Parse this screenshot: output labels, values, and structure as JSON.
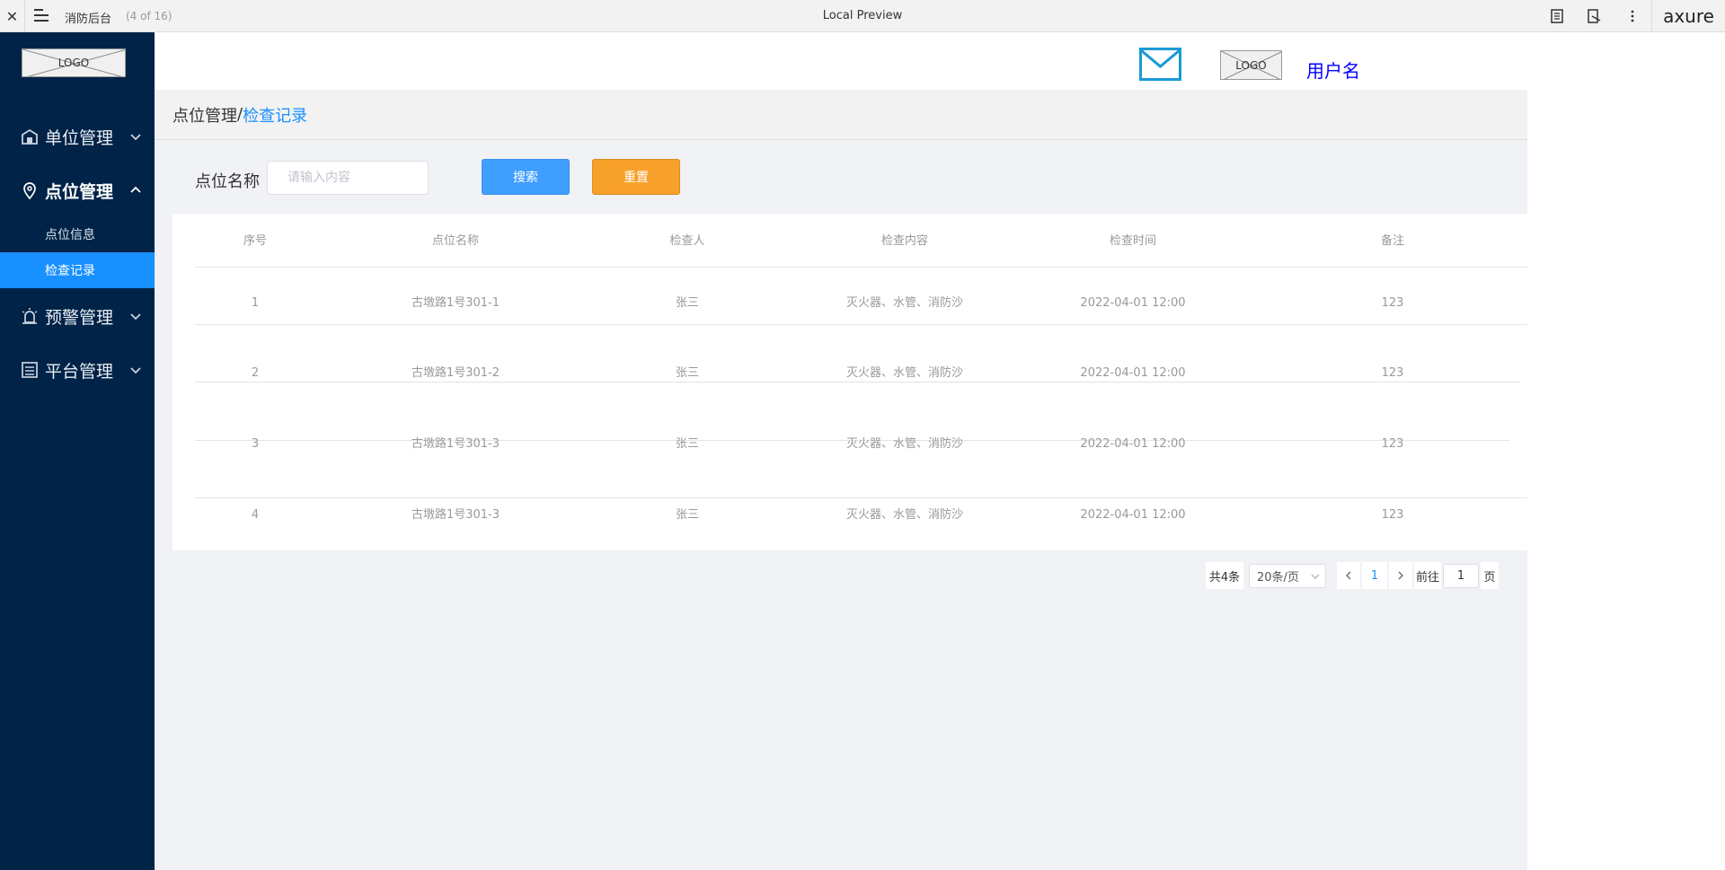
{
  "topbar": {
    "close_icon": "close-icon",
    "menu_icon": "menu-icon",
    "project": "消防后台",
    "page_count": "(4 of 16)",
    "title": "Local Preview",
    "tools": [
      "notes-icon",
      "inspect-icon",
      "more-vertical-icon"
    ],
    "brand": "axure"
  },
  "sidebar": {
    "logo": "LOGO",
    "items": [
      {
        "label": "单位管理",
        "icon": "building-icon",
        "open": false
      },
      {
        "label": "点位管理",
        "icon": "location-pin-icon",
        "open": true,
        "children": [
          {
            "label": "点位信息",
            "active": false
          },
          {
            "label": "检查记录",
            "active": true
          }
        ]
      },
      {
        "label": "预警管理",
        "icon": "alarm-icon",
        "open": false
      },
      {
        "label": "平台管理",
        "icon": "document-list-icon",
        "open": false
      }
    ]
  },
  "header": {
    "mail_icon": "mail-icon",
    "avatar_logo": "LOGO",
    "username": "用户名"
  },
  "breadcrumb": {
    "parent": "点位管理",
    "separator": "/",
    "current": "检查记录"
  },
  "filter": {
    "label": "点位名称",
    "placeholder": "请输入内容",
    "search_label": "搜索",
    "reset_label": "重置"
  },
  "table": {
    "columns": [
      "序号",
      "点位名称",
      "检查人",
      "检查内容",
      "检查时间",
      "备注"
    ],
    "rows": [
      [
        "1",
        "古墩路1号301-1",
        "张三",
        "灭火器、水管、消防沙",
        "2022-04-01 12:00",
        "123"
      ],
      [
        "2",
        "古墩路1号301-2",
        "张三",
        "灭火器、水管、消防沙",
        "2022-04-01 12:00",
        "123"
      ],
      [
        "3",
        "古墩路1号301-3",
        "张三",
        "灭火器、水管、消防沙",
        "2022-04-01 12:00",
        "123"
      ],
      [
        "4",
        "古墩路1号301-3",
        "张三",
        "灭火器、水管、消防沙",
        "2022-04-01 12:00",
        "123"
      ]
    ]
  },
  "pagination": {
    "total": "共4条",
    "page_size": "20条/页",
    "current_page": "1",
    "goto_label": "前往",
    "goto_value": "1",
    "page_word": "页"
  },
  "colors": {
    "sidebar_bg": "#002347",
    "active": "#1890ff",
    "search_btn": "#409eff",
    "reset_btn": "#f7a12b",
    "username": "#0000ff",
    "mail": "#1a9ad6"
  }
}
